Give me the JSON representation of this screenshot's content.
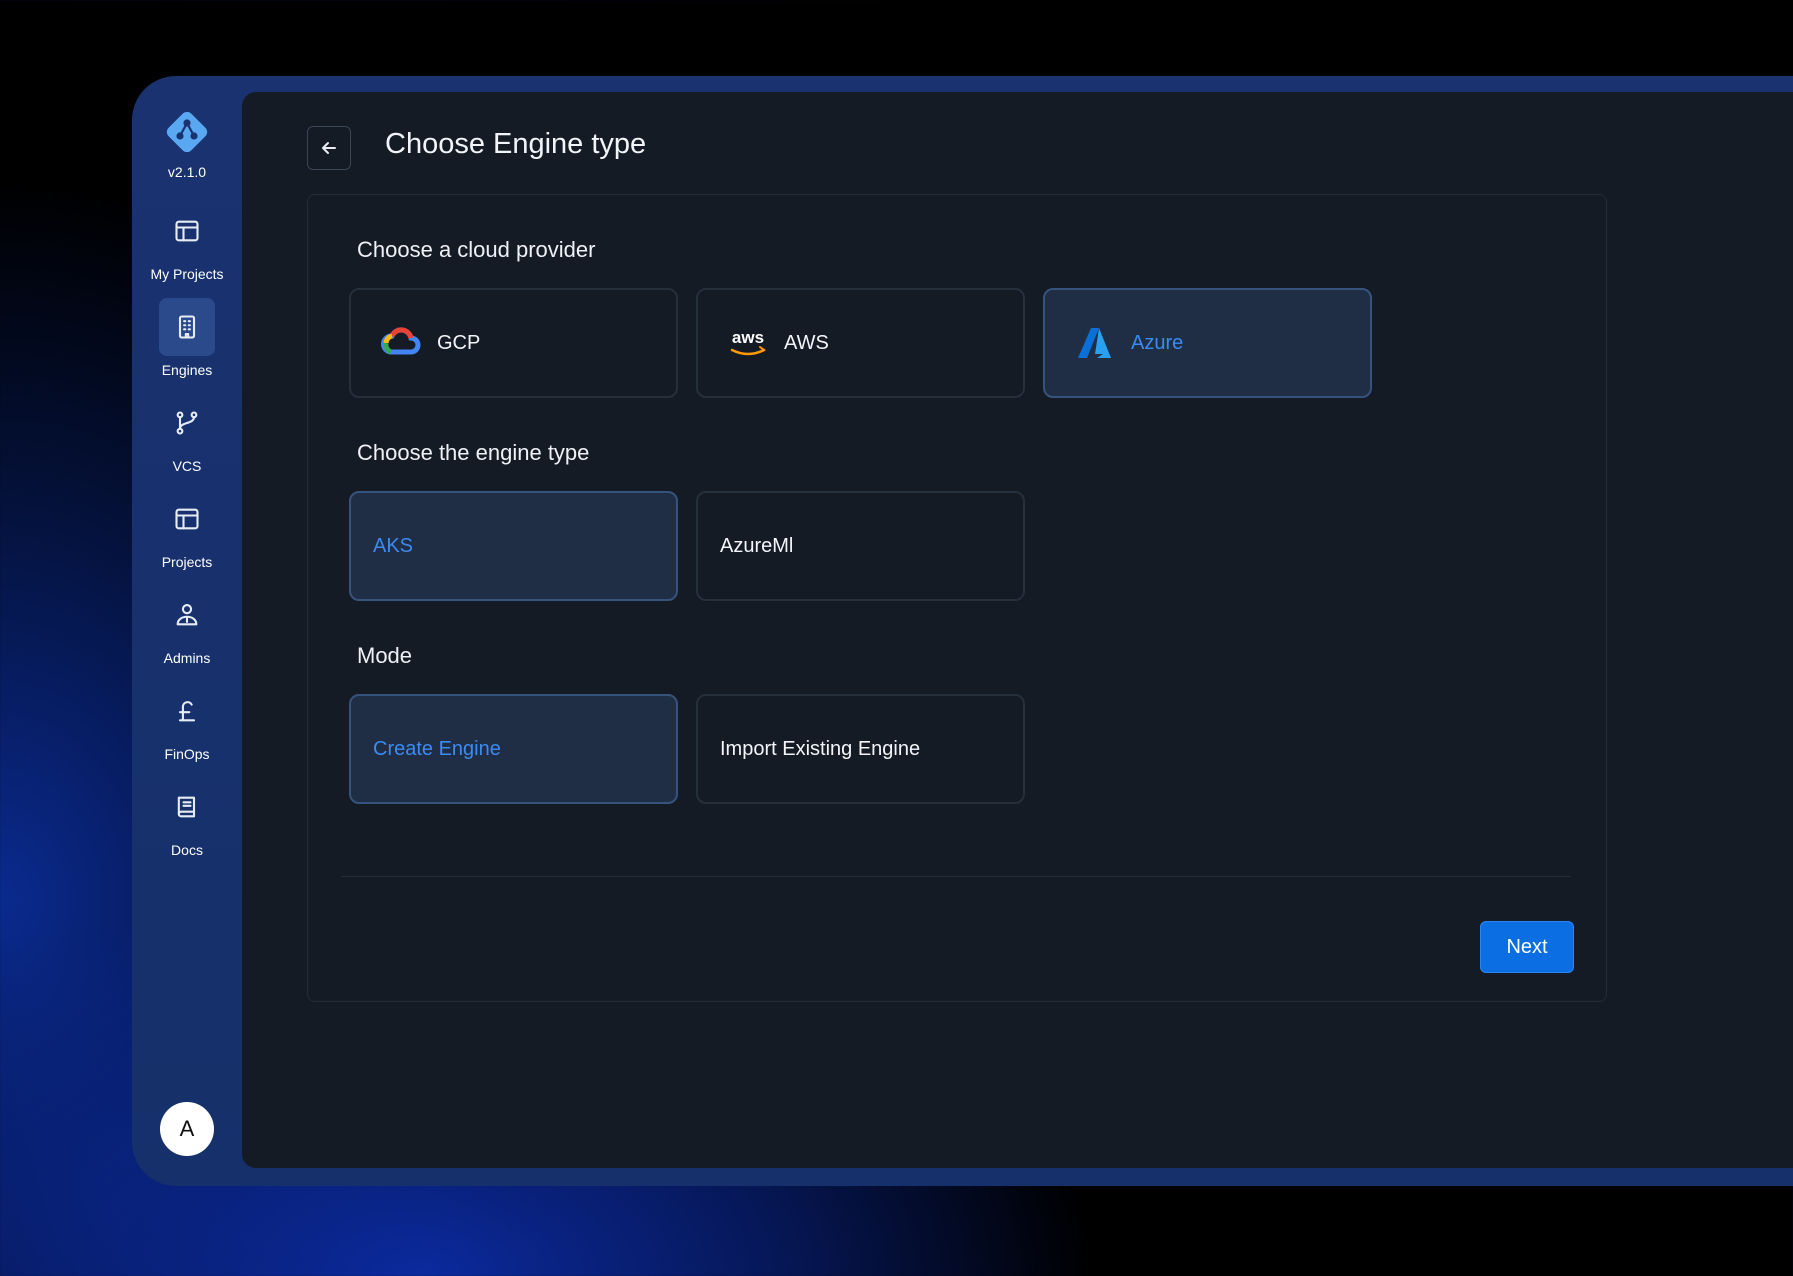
{
  "app": {
    "version": "v2.1.0",
    "avatar_initial": "A"
  },
  "sidebar": {
    "items": [
      {
        "label": "My Projects",
        "icon": "layout-icon",
        "active": false
      },
      {
        "label": "Engines",
        "icon": "building-icon",
        "active": true
      },
      {
        "label": "VCS",
        "icon": "git-branch-icon",
        "active": false
      },
      {
        "label": "Projects",
        "icon": "layout-icon",
        "active": false
      },
      {
        "label": "Admins",
        "icon": "admin-user-icon",
        "active": false
      },
      {
        "label": "FinOps",
        "icon": "pound-icon",
        "active": false
      },
      {
        "label": "Docs",
        "icon": "book-icon",
        "active": false
      }
    ]
  },
  "header": {
    "title": "Choose Engine type"
  },
  "sections": {
    "provider": {
      "title": "Choose a cloud provider",
      "options": [
        {
          "label": "GCP",
          "icon": "gcp-logo",
          "selected": false
        },
        {
          "label": "AWS",
          "icon": "aws-logo",
          "selected": false
        },
        {
          "label": "Azure",
          "icon": "azure-logo",
          "selected": true
        }
      ]
    },
    "engine_type": {
      "title": "Choose the engine type",
      "options": [
        {
          "label": "AKS",
          "selected": true
        },
        {
          "label": "AzureMl",
          "selected": false
        }
      ]
    },
    "mode": {
      "title": "Mode",
      "options": [
        {
          "label": "Create Engine",
          "selected": true
        },
        {
          "label": "Import Existing Engine",
          "selected": false
        }
      ]
    }
  },
  "footer": {
    "next_label": "Next"
  },
  "colors": {
    "accent": "#3b8bf2",
    "primary_button": "#0b6fe3",
    "sidebar_bg": "#15306a",
    "main_bg": "#151b24",
    "selected_card_bg": "#1f2e45"
  }
}
